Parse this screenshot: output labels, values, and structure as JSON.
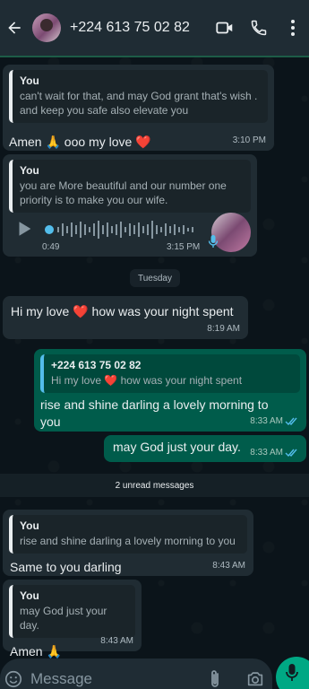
{
  "header": {
    "contact_name": "+224 613 75 02 82"
  },
  "messages": {
    "m1": {
      "quote_author": "You",
      "quote_text": "can't wait for that, and may God grant that's wish . and keep you safe also elevate you",
      "text_before": "Amen ",
      "emoji1": "🙏",
      "text_mid": " ooo my love ",
      "emoji2": "❤️",
      "time": "3:10 PM"
    },
    "m2": {
      "quote_author": "You",
      "quote_text": "you are More beautiful and our number one priority is to make you our wife.",
      "voice_duration": "0:49",
      "time": "3:15 PM"
    },
    "day_separator": "Tuesday",
    "m3": {
      "text_before": "Hi my love ",
      "emoji": "❤️",
      "text_after": " how was your night spent",
      "time": "8:19 AM"
    },
    "m4": {
      "quote_author": "+224 613 75 02 82",
      "quote_text_before": "Hi my love ",
      "quote_emoji": "❤️",
      "quote_text_after": " how was your night spent",
      "text": "rise and shine darling a lovely morning to you",
      "time": "8:33 AM"
    },
    "m5": {
      "text": "may God just your day.",
      "time": "8:33 AM"
    },
    "unread_label": "2 unread messages",
    "m6": {
      "quote_author": "You",
      "quote_text": "rise and shine darling a lovely morning to you",
      "text": "Same to you darling",
      "time": "8:43 AM"
    },
    "m7": {
      "quote_author": "You",
      "quote_text": "may God just your day.",
      "text_before": "Amen ",
      "emoji": "🙏",
      "time": "8:43 AM"
    }
  },
  "input": {
    "placeholder": "Message"
  },
  "colors": {
    "header_bg": "#1f2c34",
    "incoming_bubble": "#202c33",
    "outgoing_bubble": "#005c4b",
    "accent_green": "#00a884",
    "read_ticks": "#53bdeb"
  }
}
